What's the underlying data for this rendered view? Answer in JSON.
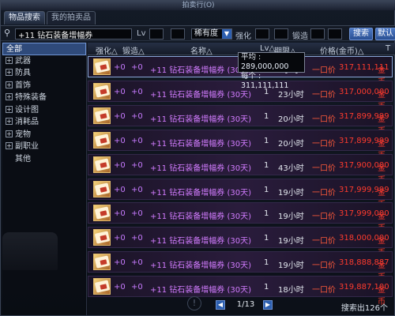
{
  "window": {
    "title": "拍卖行(O)"
  },
  "tabs": [
    {
      "label": "物品搜索",
      "active": true
    },
    {
      "label": "我的拍卖品",
      "active": false
    }
  ],
  "search": {
    "query": "+11 钻石装备增幅券",
    "lv_label": "Lv",
    "rarity_label": "稀有度",
    "enhance_label": "强化",
    "forge_label": "锻造",
    "search_button": "搜索",
    "default_button": "默认"
  },
  "sidebar": {
    "items": [
      {
        "label": "全部",
        "active": true,
        "expandable": false
      },
      {
        "label": "武器",
        "expandable": true
      },
      {
        "label": "防具",
        "expandable": true
      },
      {
        "label": "首饰",
        "expandable": true
      },
      {
        "label": "特殊装备",
        "expandable": true
      },
      {
        "label": "设计图",
        "expandable": true
      },
      {
        "label": "消耗品",
        "expandable": true
      },
      {
        "label": "宠物",
        "expandable": true
      },
      {
        "label": "副职业",
        "expandable": true
      },
      {
        "label": "其他",
        "expandable": false
      }
    ]
  },
  "table": {
    "headers": {
      "enhance": "强化△",
      "forge": "锻造△",
      "name": "名称△",
      "lv": "Lv△",
      "period": "期限△",
      "price": "价格(金币)△",
      "last": "T"
    },
    "rows": [
      {
        "enhance": "+0",
        "forge": "+0",
        "name": "+11 钻石装备增幅券 (30天)",
        "qty": "1",
        "time": "2小时",
        "type": "一口价",
        "price": "317,111,111",
        "unit": "金币",
        "selected": true
      },
      {
        "enhance": "+0",
        "forge": "+0",
        "name": "+11 钻石装备增幅券 (30天)",
        "qty": "1",
        "time": "23小时",
        "type": "一口价",
        "price": "317,000,000",
        "unit": "金币",
        "selected": false
      },
      {
        "enhance": "+0",
        "forge": "+0",
        "name": "+11 钻石装备增幅券 (30天)",
        "qty": "1",
        "time": "20小时",
        "type": "一口价",
        "price": "317,899,999",
        "unit": "金币",
        "selected": false
      },
      {
        "enhance": "+0",
        "forge": "+0",
        "name": "+11 钻石装备增幅券 (30天)",
        "qty": "1",
        "time": "20小时",
        "type": "一口价",
        "price": "317,899,999",
        "unit": "金币",
        "selected": false
      },
      {
        "enhance": "+0",
        "forge": "+0",
        "name": "+11 钻石装备增幅券 (30天)",
        "qty": "1",
        "time": "43小时",
        "type": "一口价",
        "price": "317,900,000",
        "unit": "金币",
        "selected": false
      },
      {
        "enhance": "+0",
        "forge": "+0",
        "name": "+11 钻石装备增幅券 (30天)",
        "qty": "1",
        "time": "19小时",
        "type": "一口价",
        "price": "317,999,999",
        "unit": "金币",
        "selected": false
      },
      {
        "enhance": "+0",
        "forge": "+0",
        "name": "+11 钻石装备增幅券 (30天)",
        "qty": "1",
        "time": "19小时",
        "type": "一口价",
        "price": "317,999,000",
        "unit": "金币",
        "selected": false
      },
      {
        "enhance": "+0",
        "forge": "+0",
        "name": "+11 钻石装备增幅券 (30天)",
        "qty": "1",
        "time": "19小时",
        "type": "一口价",
        "price": "318,000,000",
        "unit": "金币",
        "selected": false
      },
      {
        "enhance": "+0",
        "forge": "+0",
        "name": "+11 钻石装备增幅券 (30天)",
        "qty": "1",
        "time": "19小时",
        "type": "一口价",
        "price": "318,888,887",
        "unit": "金币",
        "selected": false
      },
      {
        "enhance": "+0",
        "forge": "+0",
        "name": "+11 钻石装备增幅券 (30天)",
        "qty": "1",
        "time": "18小时",
        "type": "一口价",
        "price": "319,887,100",
        "unit": "金币",
        "selected": false
      }
    ]
  },
  "tooltip": {
    "avg_label": "平均",
    "avg_value": "289,000,000",
    "each_label": "每个",
    "each_value": "311,111,111"
  },
  "footer": {
    "page": "1/13",
    "total": "搜索出126个"
  },
  "icons": {
    "search": "search-icon",
    "rarity_dropdown": "chevron-down-icon",
    "pager_prev": "triangle-left-icon",
    "pager_next": "triangle-right-icon",
    "info": "exclamation-icon",
    "item": "coupon-icon"
  }
}
